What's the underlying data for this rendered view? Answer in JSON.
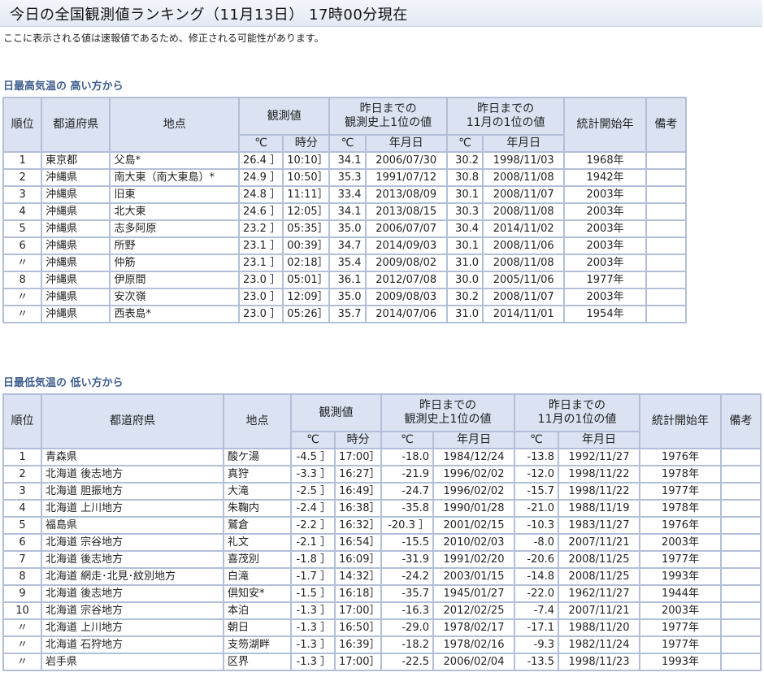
{
  "page": {
    "title": "今日の全国観測値ランキング（11月13日） 17時00分現在",
    "notice": "ここに表示される値は速報値であるため、修正される可能性があります。"
  },
  "headers": {
    "rank": "順位",
    "pref": "都道府県",
    "place": "地点",
    "observed": "観測値",
    "record_all": "昨日までの\n観測史上1位の値",
    "record_month": "昨日までの\n11月の1位の値",
    "start_year": "統計開始年",
    "remarks": "備考",
    "unit_c": "℃",
    "time": "時分",
    "date": "年月日"
  },
  "high_table": {
    "title": "日最高気温の 高い方から",
    "rows": [
      {
        "rank": "1",
        "pref": "東京都",
        "place": "父島*",
        "value": "26.4 ］",
        "time": "10:10］",
        "rec": "34.1",
        "rec_date": "2006/07/30",
        "mrec": "30.2",
        "mrec_date": "1998/11/03",
        "start": "1968年",
        "note": ""
      },
      {
        "rank": "2",
        "pref": "沖縄県",
        "place": "南大東（南大東島）*",
        "value": "24.9 ］",
        "time": "10:50］",
        "rec": "35.3",
        "rec_date": "1991/07/12",
        "mrec": "30.8",
        "mrec_date": "2008/11/08",
        "start": "1942年",
        "note": ""
      },
      {
        "rank": "3",
        "pref": "沖縄県",
        "place": "旧東",
        "value": "24.8 ］",
        "time": "11:11］",
        "rec": "33.4",
        "rec_date": "2013/08/09",
        "mrec": "30.1",
        "mrec_date": "2008/11/07",
        "start": "2003年",
        "note": ""
      },
      {
        "rank": "4",
        "pref": "沖縄県",
        "place": "北大東",
        "value": "24.6 ］",
        "time": "12:05］",
        "rec": "34.1",
        "rec_date": "2013/08/15",
        "mrec": "30.3",
        "mrec_date": "2008/11/08",
        "start": "2003年",
        "note": ""
      },
      {
        "rank": "5",
        "pref": "沖縄県",
        "place": "志多阿原",
        "value": "23.2 ］",
        "time": "05:35］",
        "rec": "35.0",
        "rec_date": "2006/07/07",
        "mrec": "30.4",
        "mrec_date": "2014/11/02",
        "start": "2003年",
        "note": ""
      },
      {
        "rank": "6",
        "pref": "沖縄県",
        "place": "所野",
        "value": "23.1 ］",
        "time": "00:39］",
        "rec": "34.7",
        "rec_date": "2014/09/03",
        "mrec": "30.1",
        "mrec_date": "2008/11/06",
        "start": "2003年",
        "note": ""
      },
      {
        "rank": "〃",
        "pref": "沖縄県",
        "place": "仲筋",
        "value": "23.1 ］",
        "time": "02:18］",
        "rec": "35.4",
        "rec_date": "2009/08/02",
        "mrec": "31.0",
        "mrec_date": "2008/11/08",
        "start": "2003年",
        "note": ""
      },
      {
        "rank": "8",
        "pref": "沖縄県",
        "place": "伊原間",
        "value": "23.0 ］",
        "time": "05:01］",
        "rec": "36.1",
        "rec_date": "2012/07/08",
        "mrec": "30.0",
        "mrec_date": "2005/11/06",
        "start": "1977年",
        "note": ""
      },
      {
        "rank": "〃",
        "pref": "沖縄県",
        "place": "安次嶺",
        "value": "23.0 ］",
        "time": "12:09］",
        "rec": "35.0",
        "rec_date": "2009/08/03",
        "mrec": "30.2",
        "mrec_date": "2008/11/07",
        "start": "2003年",
        "note": ""
      },
      {
        "rank": "〃",
        "pref": "沖縄県",
        "place": "西表島*",
        "value": "23.0 ］",
        "time": "05:26］",
        "rec": "35.7",
        "rec_date": "2014/07/06",
        "mrec": "31.0",
        "mrec_date": "2014/11/01",
        "start": "1954年",
        "note": ""
      }
    ]
  },
  "low_table": {
    "title": "日最低気温の 低い方から",
    "rows": [
      {
        "rank": "1",
        "pref": "青森県",
        "place": "酸ケ湯",
        "value": "-4.5 ］",
        "time": "17:00］",
        "rec": "-18.0",
        "rec_date": "1984/12/24",
        "mrec": "-13.8",
        "mrec_date": "1992/11/27",
        "start": "1976年",
        "note": ""
      },
      {
        "rank": "2",
        "pref": "北海道 後志地方",
        "place": "真狩",
        "value": "-3.3 ］",
        "time": "16:27］",
        "rec": "-21.9",
        "rec_date": "1996/02/02",
        "mrec": "-12.0",
        "mrec_date": "1998/11/22",
        "start": "1978年",
        "note": ""
      },
      {
        "rank": "3",
        "pref": "北海道 胆振地方",
        "place": "大滝",
        "value": "-2.5 ］",
        "time": "16:49］",
        "rec": "-24.7",
        "rec_date": "1996/02/02",
        "mrec": "-15.7",
        "mrec_date": "1998/11/22",
        "start": "1977年",
        "note": ""
      },
      {
        "rank": "4",
        "pref": "北海道 上川地方",
        "place": "朱鞠内",
        "value": "-2.4 ］",
        "time": "16:38］",
        "rec": "-35.8",
        "rec_date": "1990/01/28",
        "mrec": "-21.0",
        "mrec_date": "1988/11/19",
        "start": "1978年",
        "note": ""
      },
      {
        "rank": "5",
        "pref": "福島県",
        "place": "鷲倉",
        "value": "-2.2 ］",
        "time": "16:32］",
        "rec": "-20.3 ］",
        "rec_date": "2001/02/15",
        "mrec": "-10.3",
        "mrec_date": "1983/11/27",
        "start": "1976年",
        "note": ""
      },
      {
        "rank": "6",
        "pref": "北海道 宗谷地方",
        "place": "礼文",
        "value": "-2.1 ］",
        "time": "16:54］",
        "rec": "-15.5",
        "rec_date": "2010/02/03",
        "mrec": "-8.0",
        "mrec_date": "2007/11/21",
        "start": "2003年",
        "note": ""
      },
      {
        "rank": "7",
        "pref": "北海道 後志地方",
        "place": "喜茂別",
        "value": "-1.8 ］",
        "time": "16:09］",
        "rec": "-31.9",
        "rec_date": "1991/02/20",
        "mrec": "-20.6",
        "mrec_date": "2008/11/25",
        "start": "1977年",
        "note": ""
      },
      {
        "rank": "8",
        "pref": "北海道 網走･北見･紋別地方",
        "place": "白滝",
        "value": "-1.7 ］",
        "time": "14:32］",
        "rec": "-24.2",
        "rec_date": "2003/01/15",
        "mrec": "-14.8",
        "mrec_date": "2008/11/25",
        "start": "1993年",
        "note": ""
      },
      {
        "rank": "9",
        "pref": "北海道 後志地方",
        "place": "倶知安*",
        "value": "-1.5 ］",
        "time": "16:18］",
        "rec": "-35.7",
        "rec_date": "1945/01/27",
        "mrec": "-22.0",
        "mrec_date": "1962/11/27",
        "start": "1944年",
        "note": ""
      },
      {
        "rank": "10",
        "pref": "北海道 宗谷地方",
        "place": "本泊",
        "value": "-1.3 ］",
        "time": "17:00］",
        "rec": "-16.3",
        "rec_date": "2012/02/25",
        "mrec": "-7.4",
        "mrec_date": "2007/11/21",
        "start": "2003年",
        "note": ""
      },
      {
        "rank": "〃",
        "pref": "北海道 上川地方",
        "place": "朝日",
        "value": "-1.3 ］",
        "time": "16:50］",
        "rec": "-29.0",
        "rec_date": "1978/02/17",
        "mrec": "-17.1",
        "mrec_date": "1988/11/20",
        "start": "1977年",
        "note": ""
      },
      {
        "rank": "〃",
        "pref": "北海道 石狩地方",
        "place": "支笏湖畔",
        "value": "-1.3 ］",
        "time": "16:39］",
        "rec": "-18.2",
        "rec_date": "1978/02/16",
        "mrec": "-9.3",
        "mrec_date": "1982/11/24",
        "start": "1977年",
        "note": ""
      },
      {
        "rank": "〃",
        "pref": "岩手県",
        "place": "区界",
        "value": "-1.3 ］",
        "time": "17:00］",
        "rec": "-22.5",
        "rec_date": "2006/02/04",
        "mrec": "-13.5",
        "mrec_date": "1998/11/23",
        "start": "1993年",
        "note": ""
      }
    ]
  }
}
